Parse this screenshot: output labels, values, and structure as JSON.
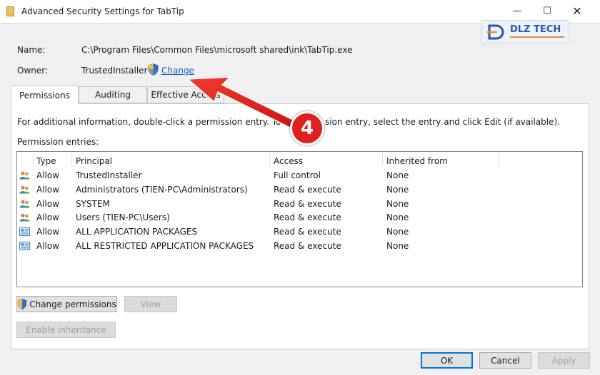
{
  "window": {
    "title": "Advanced Security Settings for TabTip",
    "minimize_glyph": "—",
    "maximize_glyph": "☐",
    "close_glyph": "✕"
  },
  "watermark": {
    "text": "DLZ TECH"
  },
  "name": {
    "label": "Name:",
    "value": "C:\\Program Files\\Common Files\\microsoft shared\\ink\\TabTip.exe"
  },
  "owner": {
    "label": "Owner:",
    "value": "TrustedInstaller",
    "change_label": "Change"
  },
  "tabs": [
    {
      "label": "Permissions",
      "active": true
    },
    {
      "label": "Auditing",
      "active": false
    },
    {
      "label": "Effective Access",
      "active": false
    }
  ],
  "info": {
    "text_left": "For additional information, double-click a permission entry. To modify",
    "text_right": "sion entry, select the entry and click Edit (if available)."
  },
  "entries": {
    "label": "Permission entries:",
    "columns": [
      "Type",
      "Principal",
      "Access",
      "Inherited from"
    ],
    "rows": [
      {
        "icon": "user-group-icon",
        "type": "Allow",
        "principal": "TrustedInstaller",
        "access": "Full control",
        "inherited": "None"
      },
      {
        "icon": "user-group-icon",
        "type": "Allow",
        "principal": "Administrators (TIEN-PC\\Administrators)",
        "access": "Read & execute",
        "inherited": "None"
      },
      {
        "icon": "user-group-icon",
        "type": "Allow",
        "principal": "SYSTEM",
        "access": "Read & execute",
        "inherited": "None"
      },
      {
        "icon": "user-group-icon",
        "type": "Allow",
        "principal": "Users (TIEN-PC\\Users)",
        "access": "Read & execute",
        "inherited": "None"
      },
      {
        "icon": "app-package-icon",
        "type": "Allow",
        "principal": "ALL APPLICATION PACKAGES",
        "access": "Read & execute",
        "inherited": "None"
      },
      {
        "icon": "app-package-icon",
        "type": "Allow",
        "principal": "ALL RESTRICTED APPLICATION PACKAGES",
        "access": "Read & execute",
        "inherited": "None"
      }
    ]
  },
  "buttons": {
    "change_permissions": "Change permissions",
    "view": "View",
    "enable_inheritance": "Enable inheritance",
    "ok": "OK",
    "cancel": "Cancel",
    "apply": "Apply"
  },
  "annotation": {
    "step": "4"
  },
  "colors": {
    "link": "#1b5ec8",
    "annotation_red": "#e0201c",
    "focus_border": "#0078d7"
  }
}
